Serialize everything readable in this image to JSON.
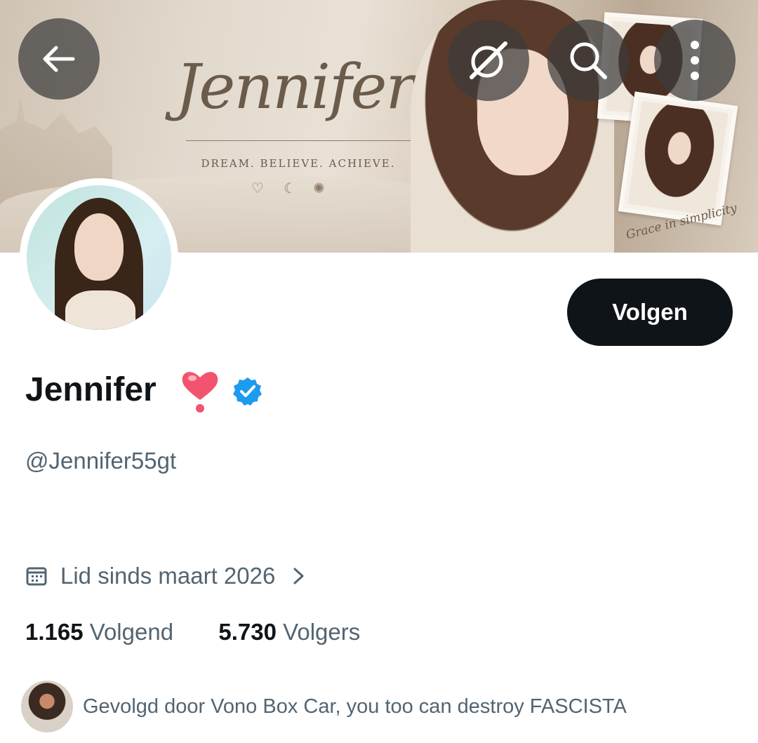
{
  "banner": {
    "title": "Jennifer",
    "tagline": "DREAM. BELIEVE. ACHIEVE.",
    "caption": "Grace in simplicity"
  },
  "toolbar": {
    "back_icon": "arrow-left-icon",
    "grok_icon": "grok-icon",
    "search_icon": "search-icon",
    "more_icon": "more-vertical-icon"
  },
  "profile": {
    "name": "Jennifer",
    "name_emoji": "heart-exclamation-emoji",
    "verified_icon": "verified-badge-icon",
    "handle": "@Jennifer55gt",
    "follow_label": "Volgen",
    "joined": "Lid sinds maart 2026",
    "following_count": "1.165",
    "following_label": "Volgend",
    "followers_count": "5.730",
    "followers_label": "Volgers",
    "followed_by": "Gevolgd door Vono Box Car, you too can destroy FASCISTA"
  },
  "colors": {
    "primary_text": "#0f1419",
    "secondary_text": "#536471",
    "verified_blue": "#1d9bf0",
    "follow_button_bg": "#0f1419"
  }
}
